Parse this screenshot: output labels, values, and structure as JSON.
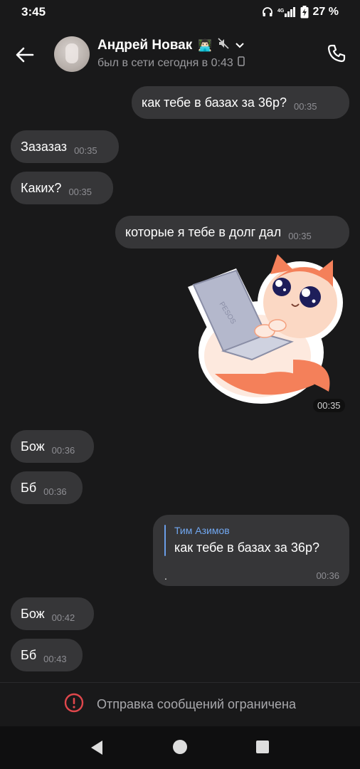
{
  "status_bar": {
    "time": "3:45",
    "battery": "27 %",
    "icons": [
      "headphones-icon",
      "signal-icon",
      "battery-icon"
    ]
  },
  "header": {
    "contact_name": "Андрей Новак",
    "name_emoji": "👨🏻‍💻",
    "last_seen": "был в сети сегодня в 0:43",
    "icons": [
      "back-arrow-icon",
      "mute-icon",
      "chevron-down-icon",
      "phone-icon",
      "device-icon"
    ]
  },
  "messages": [
    {
      "direction": "out",
      "text": "как тебе в базах за 36р?",
      "time": "00:35"
    },
    {
      "direction": "in",
      "text": "Зазазаз",
      "time": "00:35"
    },
    {
      "direction": "in",
      "text": "Каких?",
      "time": "00:35"
    },
    {
      "direction": "out",
      "text": "которые я тебе в долг дал",
      "time": "00:35"
    },
    {
      "direction": "out",
      "type": "sticker",
      "sticker_text": "PESOS",
      "time": "00:35"
    },
    {
      "direction": "in",
      "text": "Бож",
      "time": "00:36"
    },
    {
      "direction": "in",
      "text": "Бб",
      "time": "00:36"
    },
    {
      "direction": "out",
      "type": "reply",
      "reply_author": "Тим Азимов",
      "reply_text": "как тебе в базах за 36р?",
      "text": ".",
      "time": "00:36"
    },
    {
      "direction": "in",
      "text": "Бож",
      "time": "00:42"
    },
    {
      "direction": "in",
      "text": "Бб",
      "time": "00:43"
    }
  ],
  "footer": {
    "restricted_text": "Отправка сообщений ограничена",
    "icon": "alert-circle-icon",
    "accent_color": "#e0474c"
  },
  "nav_bar": {
    "icons": [
      "nav-back-icon",
      "nav-home-icon",
      "nav-recent-icon"
    ]
  }
}
